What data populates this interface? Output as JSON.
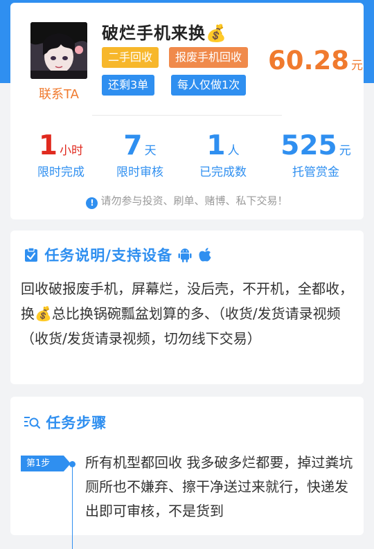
{
  "task": {
    "title": "破烂手机来换💰",
    "contact_label": "联系TA",
    "tags": [
      "二手回收",
      "报废手机回收",
      "还剩3单",
      "每人仅做1次"
    ],
    "price": {
      "amount": "60.28",
      "unit": "元"
    }
  },
  "stats": [
    {
      "value": "1",
      "unit": "小时",
      "label": "限时完成"
    },
    {
      "value": "7",
      "unit": "天",
      "label": "限时审核"
    },
    {
      "value": "1",
      "unit": "人",
      "label": "已完成数"
    },
    {
      "value": "525",
      "unit": "元",
      "label": "托管赏金"
    }
  ],
  "warning": "请勿参与投资、刷单、赌博、私下交易！",
  "description": {
    "title": "任务说明/支持设备",
    "text": "回收破报废手机，屏幕烂，没后壳，不开机，全都收，换💰总比换锅碗瓢盆划算的多、（收货/发货请录视频（收货/发货请录视频，切勿线下交易）"
  },
  "steps": {
    "title": "任务步骤",
    "items": [
      {
        "badge": "第1步",
        "text": "所有机型都回收 我多破多烂都要，掉过粪坑厕所也不嫌弃、擦干净送过来就行，快递发出即可审核，不是货到"
      }
    ]
  },
  "colors": {
    "accent": "#2f8ff0",
    "orange": "#f07a2e",
    "red": "#e02a1f",
    "yellow": "#f7b72b"
  }
}
